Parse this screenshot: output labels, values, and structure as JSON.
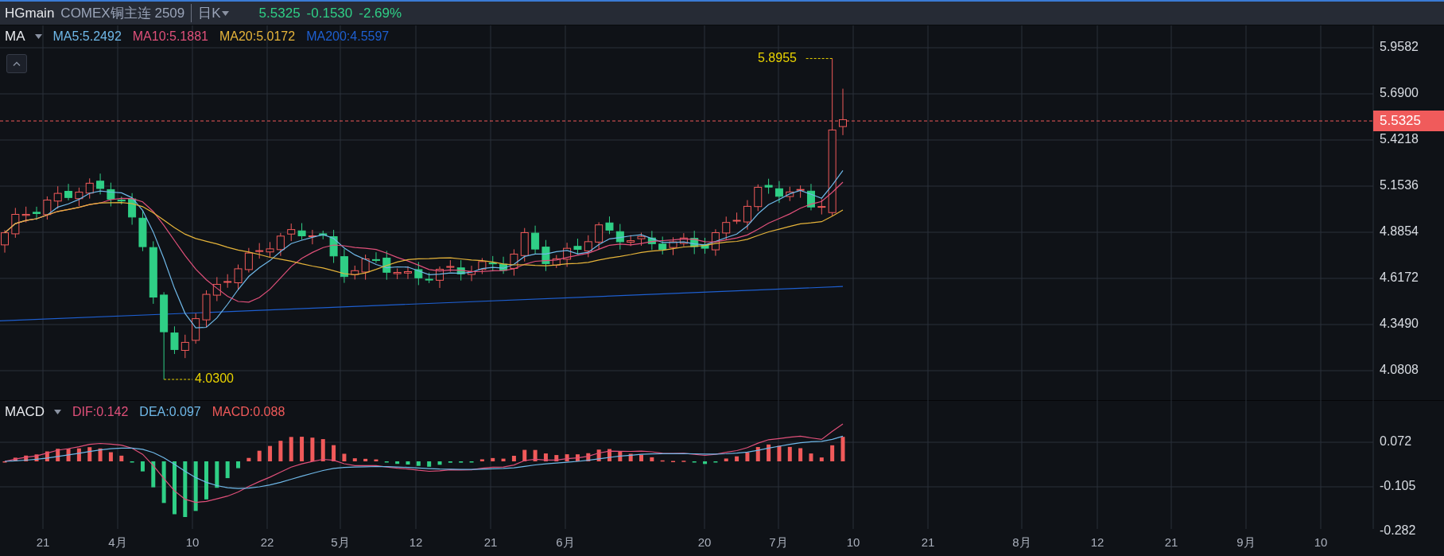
{
  "header": {
    "symbol": "HGmain",
    "name": "COMEX铜主连 2509",
    "period": "日K",
    "price": "5.5325",
    "change": "-0.1530",
    "percent": "-2.69%"
  },
  "ma_legend": {
    "title": "MA",
    "items": [
      {
        "label": "MA5:5.2492",
        "color": "#6fb8e8"
      },
      {
        "label": "MA10:5.1881",
        "color": "#e0507a"
      },
      {
        "label": "MA20:5.0172",
        "color": "#e6b43a"
      },
      {
        "label": "MA200:4.5597",
        "color": "#1e5fd0"
      }
    ]
  },
  "price_axis": [
    "5.9582",
    "5.6900",
    "5.4218",
    "5.1536",
    "4.8854",
    "4.6172",
    "4.3490",
    "4.0808"
  ],
  "current_price": "5.5325",
  "high_marker": "5.8955",
  "low_marker": "4.0300",
  "macd_legend": {
    "title": "MACD",
    "items": [
      {
        "label": "DIF:0.142",
        "color": "#e0507a"
      },
      {
        "label": "DEA:0.097",
        "color": "#6fb8e8"
      },
      {
        "label": "MACD:0.088",
        "color": "#f05a5a"
      }
    ]
  },
  "macd_axis": [
    "0.072",
    "-0.105",
    "-0.282"
  ],
  "time_axis": [
    "21",
    "4月",
    "10",
    "22",
    "5月",
    "12",
    "21",
    "6月",
    "20",
    "7月",
    "10",
    "21",
    "8月",
    "12",
    "21",
    "9月",
    "10"
  ]
}
